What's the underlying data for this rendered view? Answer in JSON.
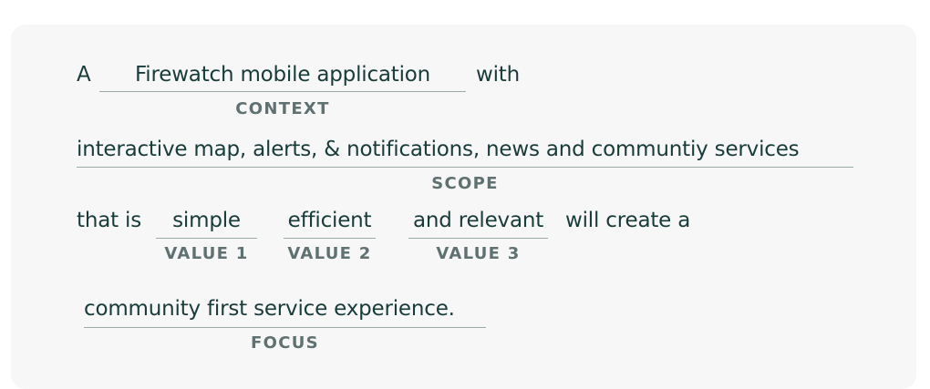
{
  "statement": {
    "line1": {
      "prefix": "A",
      "context_value": "Firewatch mobile application",
      "context_label": "CONTEXT",
      "suffix": "with"
    },
    "line2": {
      "scope_value": "interactive map, alerts, & notifications, news and communtiy services",
      "scope_label": "SCOPE"
    },
    "line3": {
      "prefix": "that is",
      "value1": "simple",
      "value1_label": "VALUE 1",
      "value2": "efficient",
      "value2_label": "VALUE 2",
      "value3": "and relevant",
      "value3_label": "VALUE 3",
      "suffix": "will create a"
    },
    "line4": {
      "focus_value": "community first service experience.",
      "focus_label": "FOCUS"
    }
  }
}
